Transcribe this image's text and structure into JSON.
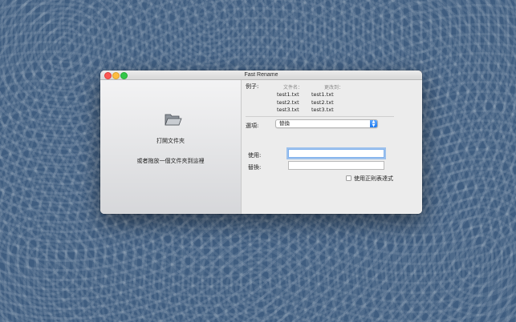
{
  "window": {
    "title": "Fast Rename"
  },
  "left_panel": {
    "folder_icon": "folder-open-icon",
    "open_folder_label": "打開文件夾",
    "drop_hint": "或者拖放一個文件夾到這裡"
  },
  "examples": {
    "label": "例子:",
    "filename_header": "文件名：",
    "changed_to_header": "更改到：",
    "rows": [
      {
        "from": "test1.txt",
        "to": "test1.txt"
      },
      {
        "from": "test2.txt",
        "to": "test2.txt"
      },
      {
        "from": "test3.txt",
        "to": "test3.txt"
      }
    ]
  },
  "options": {
    "label": "選項:",
    "selected": "替換"
  },
  "replace_form": {
    "use_label": "使用:",
    "use_value": "",
    "replace_label": "替換:",
    "replace_value": "",
    "regex_label": "使用正則表達式",
    "regex_checked": false
  },
  "colors": {
    "accent": "#1677f0",
    "close": "#fc5753",
    "minimize": "#fdbc40",
    "maximize": "#33c748"
  }
}
